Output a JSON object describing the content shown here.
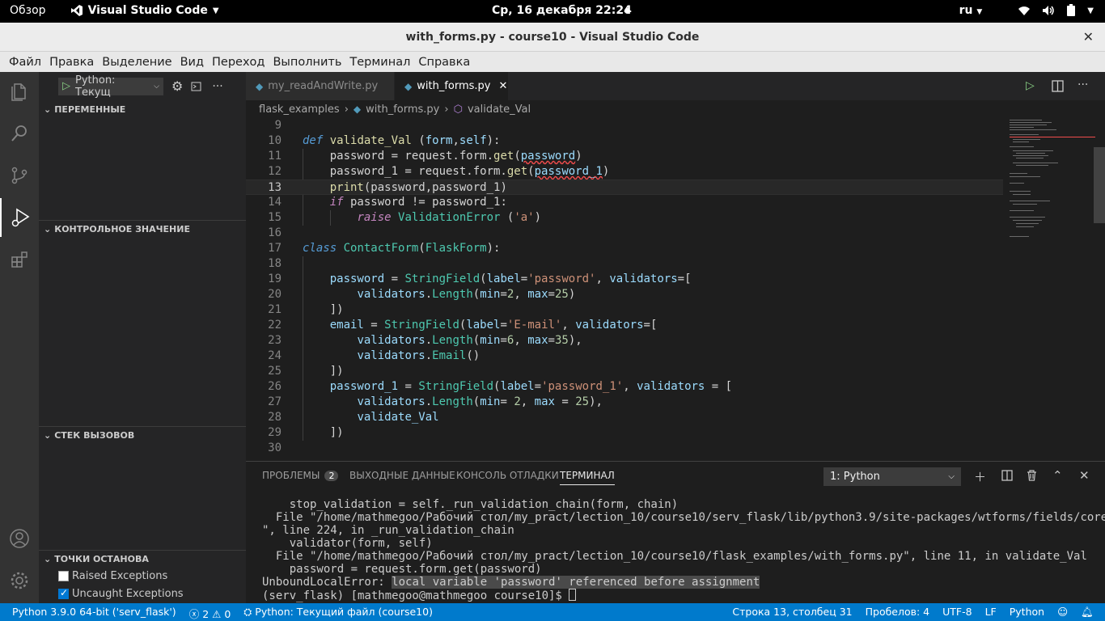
{
  "gnome": {
    "overview": "Обзор",
    "app_name": "Visual Studio Code",
    "clock": "Ср, 16 декабря  22:24",
    "lang": "ru"
  },
  "window": {
    "title": "with_forms.py - course10 - Visual Studio Code"
  },
  "menu": [
    "Файл",
    "Правка",
    "Выделение",
    "Вид",
    "Переход",
    "Выполнить",
    "Терминал",
    "Справка"
  ],
  "sidebar": {
    "run_config": "Python: Текущ",
    "sections": {
      "variables": "ПЕРЕМЕННЫЕ",
      "watch": "КОНТРОЛЬНОЕ ЗНАЧЕНИЕ",
      "callstack": "СТЕК ВЫЗОВОВ",
      "breakpoints": "ТОЧКИ ОСТАНОВА"
    },
    "breakpoints": [
      {
        "label": "Raised Exceptions",
        "checked": false
      },
      {
        "label": "Uncaught Exceptions",
        "checked": true
      }
    ]
  },
  "tabs": [
    {
      "label": "my_readAndWrite.py",
      "active": false
    },
    {
      "label": "with_forms.py",
      "active": true
    }
  ],
  "breadcrumb": {
    "folder": "flask_examples",
    "file": "with_forms.py",
    "symbol": "validate_Val"
  },
  "editor": {
    "current_line": 13,
    "lines": [
      {
        "n": "9"
      },
      {
        "n": "10"
      },
      {
        "n": "11"
      },
      {
        "n": "12"
      },
      {
        "n": "13"
      },
      {
        "n": "14"
      },
      {
        "n": "15"
      },
      {
        "n": "16"
      },
      {
        "n": "17"
      },
      {
        "n": "18"
      },
      {
        "n": "19"
      },
      {
        "n": "20"
      },
      {
        "n": "21"
      },
      {
        "n": "22"
      },
      {
        "n": "23"
      },
      {
        "n": "24"
      },
      {
        "n": "25"
      },
      {
        "n": "26"
      },
      {
        "n": "27"
      },
      {
        "n": "28"
      },
      {
        "n": "29"
      },
      {
        "n": "30"
      }
    ]
  },
  "panel": {
    "tabs": {
      "problems": "ПРОБЛЕМЫ",
      "problems_count": "2",
      "output": "ВЫХОДНЫЕ ДАННЫЕ",
      "debug_console": "КОНСОЛЬ ОТЛАДКИ",
      "terminal": "ТЕРМИНАЛ"
    },
    "terminal_select": "1: Python",
    "terminal_lines": [
      "    stop_validation = self._run_validation_chain(form, chain)",
      "  File \"/home/mathmegoo/Рабочий стол/my_pract/lection_10/course10/serv_flask/lib/python3.9/site-packages/wtforms/fields/core.py",
      "\", line 224, in _run_validation_chain",
      "    validator(form, self)",
      "  File \"/home/mathmegoo/Рабочий стол/my_pract/lection_10/course10/flask_examples/with_forms.py\", line 11, in validate_Val",
      "    password = request.form.get(password)"
    ],
    "error_prefix": "UnboundLocalError: ",
    "error_msg": "local variable 'password' referenced before assignment",
    "prompt": "(serv_flask) [mathmegoo@mathmegoo course10]$ "
  },
  "status": {
    "interpreter": "Python 3.9.0 64-bit ('serv_flask')",
    "errors": "2",
    "warnings": "0",
    "launch": "Python: Текущий файл (course10)",
    "position": "Строка 13, столбец 31",
    "indent": "Пробелов: 4",
    "encoding": "UTF-8",
    "eol": "LF",
    "language": "Python"
  }
}
